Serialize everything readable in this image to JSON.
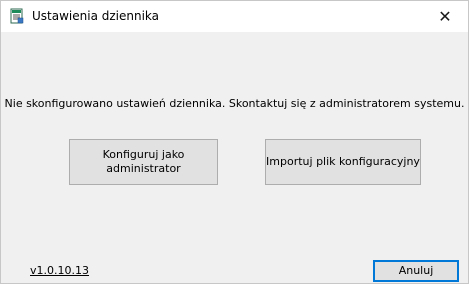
{
  "window": {
    "title": "Ustawienia dziennika",
    "close_symbol": "✕",
    "app_icon": "journal-settings-icon"
  },
  "main": {
    "message": "Nie skonfigurowano ustawień dziennika. Skontaktuj się z administratorem systemu.",
    "configure_admin_label": "Konfiguruj jako administrator",
    "import_config_label": "Importuj plik konfiguracyjny"
  },
  "footer": {
    "version_link": "v1.0.10.13",
    "cancel_label": "Anuluj"
  },
  "colors": {
    "accent": "#0078d7",
    "button_face": "#e1e1e1",
    "dialog_bg": "#f0f0f0"
  }
}
